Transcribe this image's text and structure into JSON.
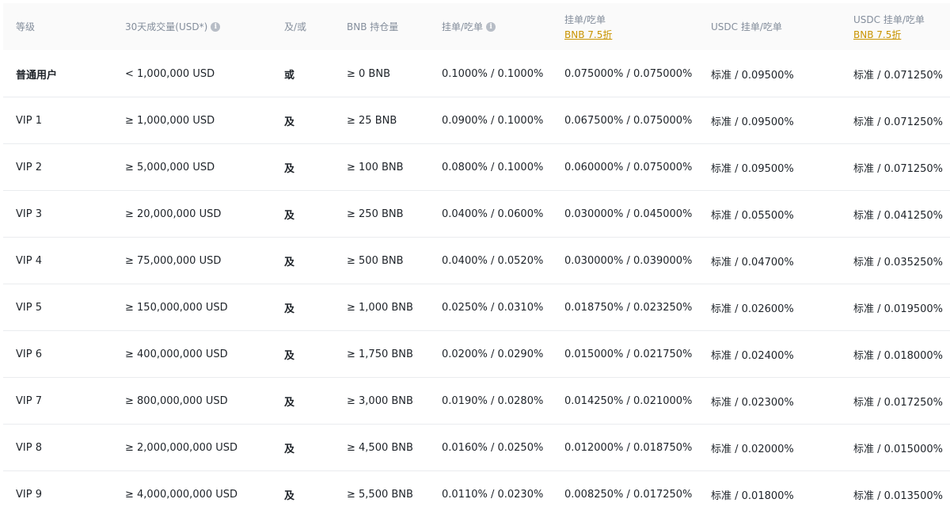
{
  "header": {
    "level": "等级",
    "volume": "30天成交量(USD*)",
    "and_or": "及/或",
    "bnb_holding": "BNB 持仓量",
    "maker_taker": "挂单/吃单",
    "maker_taker_bnb": "挂单/吃单",
    "maker_taker_bnb_sub": "BNB 7.5折",
    "usdc_maker_taker": "USDC 挂单/吃单",
    "usdc_maker_taker_bnb": "USDC 挂单/吃单",
    "usdc_maker_taker_bnb_sub": "BNB 7.5折"
  },
  "rows": [
    [
      "普通用户",
      "< 1,000,000 USD",
      "或",
      "≥ 0 BNB",
      "0.1000% / 0.1000%",
      "0.075000% / 0.075000%",
      "标准 / 0.09500%",
      "标准 / 0.071250%"
    ],
    [
      "VIP 1",
      "≥ 1,000,000 USD",
      "及",
      "≥ 25 BNB",
      "0.0900% / 0.1000%",
      "0.067500% / 0.075000%",
      "标准 / 0.09500%",
      "标准 / 0.071250%"
    ],
    [
      "VIP 2",
      "≥ 5,000,000 USD",
      "及",
      "≥ 100 BNB",
      "0.0800% / 0.1000%",
      "0.060000% / 0.075000%",
      "标准 / 0.09500%",
      "标准 / 0.071250%"
    ],
    [
      "VIP 3",
      "≥ 20,000,000 USD",
      "及",
      "≥ 250 BNB",
      "0.0400% / 0.0600%",
      "0.030000% / 0.045000%",
      "标准 / 0.05500%",
      "标准 / 0.041250%"
    ],
    [
      "VIP 4",
      "≥ 75,000,000 USD",
      "及",
      "≥ 500 BNB",
      "0.0400% / 0.0520%",
      "0.030000% / 0.039000%",
      "标准 / 0.04700%",
      "标准 / 0.035250%"
    ],
    [
      "VIP 5",
      "≥ 150,000,000 USD",
      "及",
      "≥ 1,000 BNB",
      "0.0250% / 0.0310%",
      "0.018750% / 0.023250%",
      "标准 / 0.02600%",
      "标准 / 0.019500%"
    ],
    [
      "VIP 6",
      "≥ 400,000,000 USD",
      "及",
      "≥ 1,750 BNB",
      "0.0200% / 0.0290%",
      "0.015000% / 0.021750%",
      "标准 / 0.02400%",
      "标准 / 0.018000%"
    ],
    [
      "VIP 7",
      "≥ 800,000,000 USD",
      "及",
      "≥ 3,000 BNB",
      "0.0190% / 0.0280%",
      "0.014250% / 0.021000%",
      "标准 / 0.02300%",
      "标准 / 0.017250%"
    ],
    [
      "VIP 8",
      "≥ 2,000,000,000 USD",
      "及",
      "≥ 4,500 BNB",
      "0.0160% / 0.0250%",
      "0.012000% / 0.018750%",
      "标准 / 0.02000%",
      "标准 / 0.015000%"
    ],
    [
      "VIP 9",
      "≥ 4,000,000,000 USD",
      "及",
      "≥ 5,500 BNB",
      "0.0110% / 0.0230%",
      "0.008250% / 0.017250%",
      "标准 / 0.01800%",
      "标准 / 0.013500%"
    ]
  ],
  "colors": {
    "header_bg": "#fafafa",
    "header_text": "#848e9c",
    "body_text": "#1e2329",
    "accent": "#c99400",
    "divider": "#eaecef"
  },
  "icons": {
    "info": "info-icon"
  }
}
